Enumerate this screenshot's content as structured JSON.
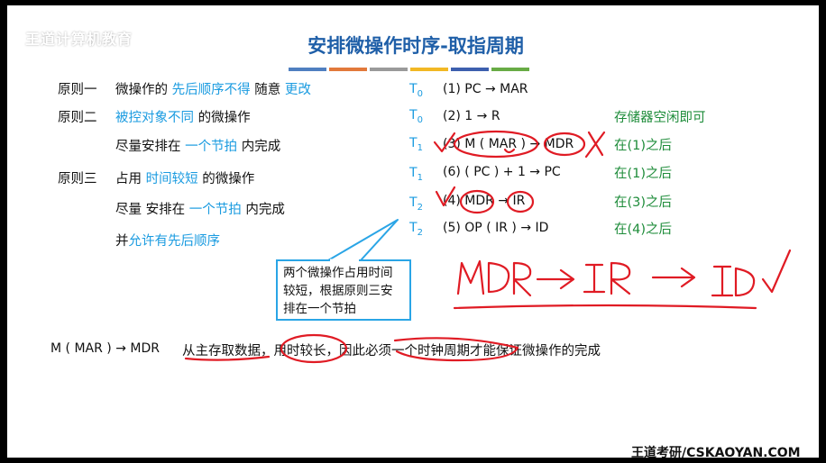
{
  "brand": "王道计算机教育",
  "title": "安排微操作时序-取指周期",
  "colors": {
    "title_blue": "#1f5fa8",
    "highlight_blue": "#1a9be0",
    "condition_green": "#1e8c3a",
    "annotation_red": "#e01b24",
    "bars": [
      "#4f7fc0",
      "#e2793b",
      "#9a9a9a",
      "#f2b824",
      "#3d5fae",
      "#68ab45"
    ]
  },
  "principles": {
    "p1_label": "原则一",
    "p1_a": "微操作的",
    "p1_b": "先后顺序不得",
    "p1_c": "随意",
    "p1_d": "更改",
    "p2_label": "原则二",
    "p2_a": "被控对象不同",
    "p2_b": "的微操作",
    "p2_c": "尽量安排在",
    "p2_d": "一个节拍",
    "p2_e": "内完成",
    "p3_label": "原则三",
    "p3_a": "占用",
    "p3_b": "时间较短",
    "p3_c": "的微操作",
    "p3_d": "尽量 安排在",
    "p3_e": "一个节拍",
    "p3_f": "内完成",
    "p3_g": "并",
    "p3_h": "允许有先后顺序"
  },
  "steps": [
    {
      "t": "T",
      "sub": "0",
      "op": "(1) PC → MAR",
      "cond": ""
    },
    {
      "t": "T",
      "sub": "0",
      "op": "(2) 1 → R",
      "cond": "存储器空闲即可"
    },
    {
      "t": "T",
      "sub": "1",
      "op": "(3) M ( MAR ) → MDR",
      "cond": "在(1)之后"
    },
    {
      "t": "T",
      "sub": "1",
      "op": "(6) ( PC ) + 1 → PC",
      "cond": "在(1)之后"
    },
    {
      "t": "T",
      "sub": "2",
      "op": "(4) MDR → IR",
      "cond": "在(3)之后"
    },
    {
      "t": "T",
      "sub": "2",
      "op": "(5) OP ( IR ) → ID",
      "cond": "在(4)之后"
    }
  ],
  "callout": "两个微操作占用时间较短，根据原则三安排在一个节拍",
  "bottom": {
    "expr": "M ( MAR ) → MDR",
    "note": "从主存取数据，用时较长，因此必须一个时钟周期才能保证微操作的完成"
  },
  "footer": "王道考研/CSKAOYAN.COM"
}
